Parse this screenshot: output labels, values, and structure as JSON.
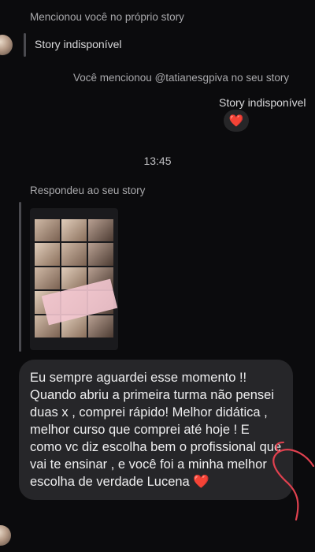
{
  "thread": [
    {
      "type": "meta",
      "text": "Mencionou você no próprio story"
    },
    {
      "type": "incoming_status",
      "text": "Story indisponível"
    },
    {
      "type": "meta_out",
      "text": "Você mencionou @tatianesgpiva no seu story"
    },
    {
      "type": "outgoing_status",
      "text": "Story indisponível"
    },
    {
      "type": "reaction",
      "emoji": "❤️"
    },
    {
      "type": "timestamp",
      "text": "13:45"
    },
    {
      "type": "meta",
      "text": "Respondeu ao seu story"
    },
    {
      "type": "message",
      "text": "Eu sempre aguardei esse momento !! Quando abriu a primeira turma não pensei duas x , comprei rápido! Melhor didática , melhor curso que comprei até hoje ! E como vc diz escolha bem o profissional que vai te ensinar , e você foi a minha melhor escolha de verdade Lucena ❤️"
    }
  ],
  "colors": {
    "background": "#0b0b0d",
    "bubble": "#262629",
    "accent": "#ff2a3a",
    "scribble": "#e0414f"
  }
}
